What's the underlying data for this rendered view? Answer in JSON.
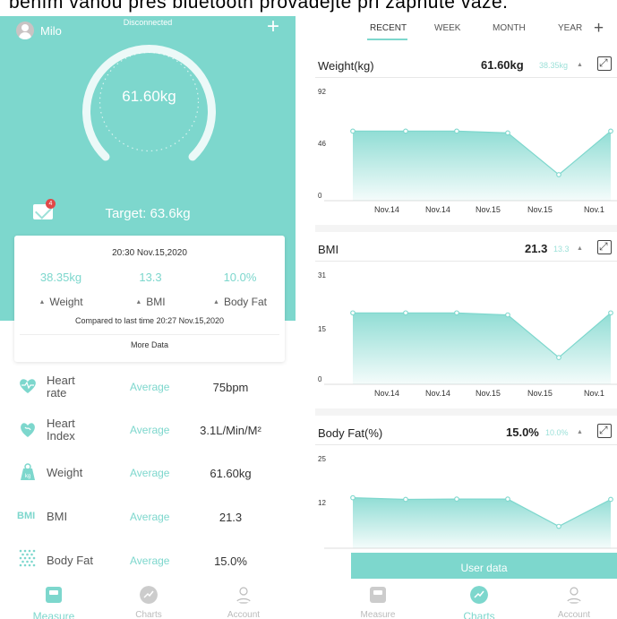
{
  "caption": "bením váhou přes bluetooth provádějte při zapnuté váze.",
  "measure": {
    "user": "Milo",
    "status": "Disconnected",
    "weight": "61.60kg",
    "target": "Target: 63.6kg",
    "badge": "4",
    "card": {
      "time": "20:30 Nov.15,2020",
      "weight_value": "38.35kg",
      "bmi_value": "13.3",
      "fat_value": "10.0%",
      "weight_label": "Weight",
      "bmi_label": "BMI",
      "fat_label": "Body Fat",
      "compare": "Compared to last time 20:27 Nov.15,2020",
      "more": "More Data"
    },
    "rows": [
      {
        "name": "Heart rate",
        "name1": "Heart",
        "name2": "rate",
        "avg": "Average",
        "value": "75bpm",
        "icon": "heart-icon"
      },
      {
        "name": "Heart Index",
        "name1": "Heart",
        "name2": "Index",
        "avg": "Average",
        "value": "3.1L/Min/M²",
        "icon": "heart-index-icon"
      },
      {
        "name": "Weight",
        "avg": "Average",
        "value": "61.60kg",
        "icon": "scale-icon",
        "icon_text": "kg"
      },
      {
        "name": "BMI",
        "avg": "Average",
        "value": "21.3",
        "icon": "bmi-icon",
        "icon_text": "BMI"
      },
      {
        "name": "Body Fat",
        "avg": "Average",
        "value": "15.0%",
        "icon": "body-fat-icon"
      }
    ]
  },
  "tabbar": {
    "measure": "Measure",
    "charts": "Charts",
    "account": "Account"
  },
  "charts": {
    "tabs": [
      "RECENT",
      "WEEK",
      "MONTH",
      "YEAR"
    ],
    "user_data": "User data",
    "accent": "#7dd7cd"
  },
  "chart_data": [
    {
      "type": "area",
      "title": "Weight(kg)",
      "current": "61.60kg",
      "previous": "38.35kg",
      "yticks": [
        "92",
        "46",
        "0"
      ],
      "ylim": [
        0,
        92
      ],
      "categories": [
        "Nov.14",
        "Nov.14",
        "Nov.15",
        "Nov.15",
        "Nov.1"
      ],
      "values": [
        61.6,
        61.6,
        61.6,
        60.0,
        23.0,
        61.6
      ]
    },
    {
      "type": "area",
      "title": "BMI",
      "current": "21.3",
      "previous": "13.3",
      "yticks": [
        "31",
        "15",
        "0"
      ],
      "ylim": [
        0,
        31
      ],
      "categories": [
        "Nov.14",
        "Nov.14",
        "Nov.15",
        "Nov.15",
        "Nov.1"
      ],
      "values": [
        21.3,
        21.3,
        21.3,
        20.7,
        8.0,
        21.3
      ]
    },
    {
      "type": "area",
      "title": "Body Fat(%)",
      "current": "15.0%",
      "previous": "10.0%",
      "yticks": [
        "25",
        "12"
      ],
      "ylim": [
        0,
        25
      ],
      "categories": [],
      "values": [
        15.0,
        14.5,
        14.6,
        14.6,
        6.5,
        14.5
      ]
    }
  ]
}
